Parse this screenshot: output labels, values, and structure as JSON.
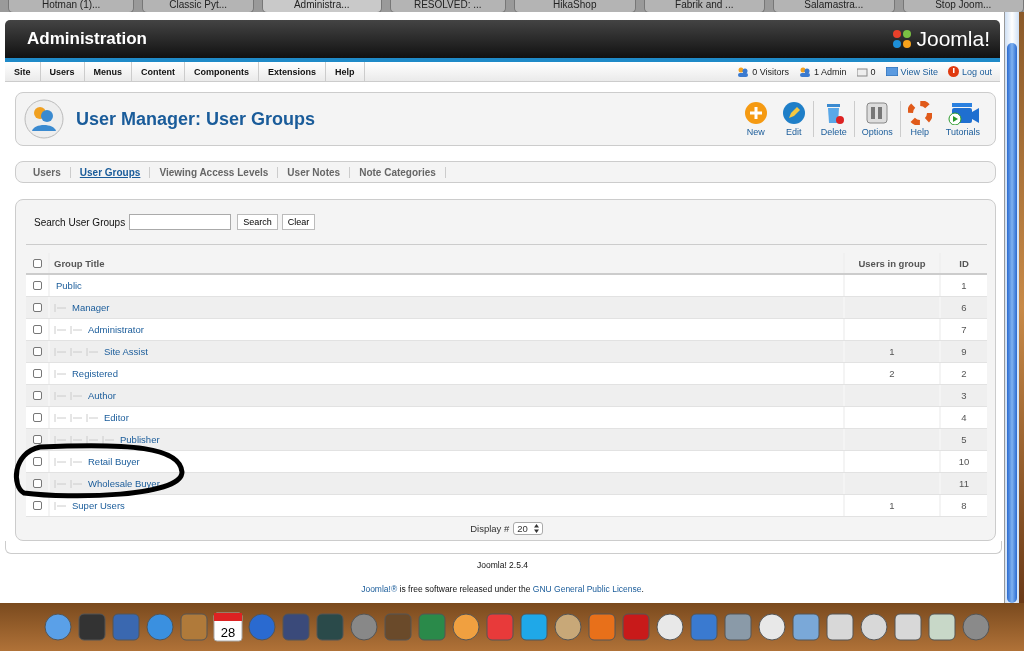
{
  "browser_tabs": [
    {
      "label": "Hotman (1)...",
      "selected": false
    },
    {
      "label": "Classic Pyt...",
      "selected": false
    },
    {
      "label": "Administra...",
      "selected": true
    },
    {
      "label": "RESOLVED: ...",
      "selected": false
    },
    {
      "label": "HikaShop",
      "selected": false
    },
    {
      "label": "Fabrik and ...",
      "selected": false
    },
    {
      "label": "Salamastra...",
      "selected": false
    },
    {
      "label": "Stop Joom...",
      "selected": false
    }
  ],
  "header": {
    "title": "Administration",
    "logo_text": "Joomla!"
  },
  "menu": {
    "items": [
      "Site",
      "Users",
      "Menus",
      "Content",
      "Components",
      "Extensions",
      "Help"
    ],
    "status": [
      {
        "kind": "visitors",
        "label": "0 Visitors"
      },
      {
        "kind": "admin",
        "label": "1 Admin"
      },
      {
        "kind": "messages",
        "label": "0"
      },
      {
        "kind": "view",
        "label": "View Site"
      },
      {
        "kind": "logout",
        "label": "Log out"
      }
    ]
  },
  "toolbar": {
    "title": "User Manager: User Groups",
    "buttons": [
      {
        "kind": "new",
        "label": "New"
      },
      {
        "kind": "edit",
        "label": "Edit"
      },
      {
        "kind": "delete",
        "label": "Delete"
      },
      {
        "kind": "options",
        "label": "Options"
      },
      {
        "kind": "help",
        "label": "Help"
      },
      {
        "kind": "tutorials",
        "label": "Tutorials"
      }
    ]
  },
  "submenu": [
    {
      "label": "Users",
      "selected": false
    },
    {
      "label": "User Groups",
      "selected": true
    },
    {
      "label": "Viewing Access Levels",
      "selected": false
    },
    {
      "label": "User Notes",
      "selected": false
    },
    {
      "label": "Note Categories",
      "selected": false
    }
  ],
  "search": {
    "label": "Search User Groups",
    "buttons": [
      "Search",
      "Clear"
    ]
  },
  "table": {
    "columns": [
      "Group Title",
      "Users in group",
      "ID"
    ],
    "header_checked": false,
    "rows": [
      {
        "title": "Public",
        "id": "1",
        "checked": false,
        "circled": false,
        "children": [
          {
            "title": "Manager",
            "id": "6",
            "checked": false,
            "circled": false,
            "children": [
              {
                "title": "Administrator",
                "id": "7",
                "checked": false,
                "circled": false,
                "children": [
                  {
                    "title": "Site Assist",
                    "users": "1",
                    "id": "9",
                    "checked": false,
                    "circled": false
                  }
                ]
              }
            ]
          },
          {
            "title": "Registered",
            "users": "2",
            "id": "2",
            "checked": false,
            "circled": false,
            "children": [
              {
                "title": "Author",
                "id": "3",
                "checked": false,
                "circled": false,
                "children": [
                  {
                    "title": "Editor",
                    "id": "4",
                    "checked": false,
                    "circled": false,
                    "children": [
                      {
                        "title": "Publisher",
                        "id": "5",
                        "checked": false,
                        "circled": false
                      }
                    ]
                  }
                ]
              },
              {
                "title": "Retail Buyer",
                "id": "10",
                "checked": false,
                "circled": true
              },
              {
                "title": "Wholesale Buyer",
                "id": "11",
                "checked": false,
                "circled": true
              }
            ]
          },
          {
            "title": "Super Users",
            "users": "1",
            "id": "8",
            "checked": false,
            "circled": false
          }
        ]
      }
    ]
  },
  "pagination": {
    "label": "Display #",
    "value": "20"
  },
  "footer": {
    "version": "Joomla! 2.5.4",
    "license_parts": [
      {
        "kind": "link",
        "text": "Joomla!®"
      },
      {
        "kind": "text",
        "text": " is free software released under the "
      },
      {
        "kind": "link",
        "text": "GNU General Public License"
      },
      {
        "kind": "text",
        "text": "."
      }
    ]
  },
  "dock": {
    "calendar_date": "28"
  }
}
